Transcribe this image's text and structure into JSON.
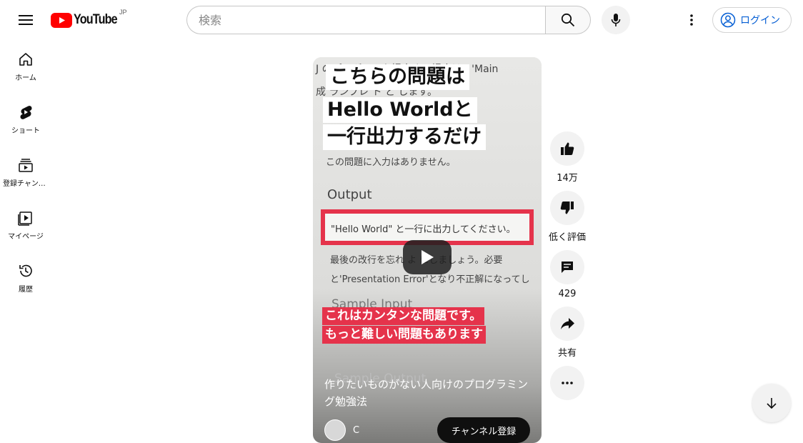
{
  "header": {
    "logo_text": "YouTube",
    "region": "JP",
    "search_placeholder": "検索",
    "login_label": "ログイン"
  },
  "sidebar": {
    "items": [
      {
        "label": "ホーム",
        "icon": "home-icon"
      },
      {
        "label": "ショート",
        "icon": "shorts-icon"
      },
      {
        "label": "登録チャンネル",
        "icon": "subscriptions-icon"
      },
      {
        "label": "マイページ",
        "icon": "library-icon"
      },
      {
        "label": "履歴",
        "icon": "history-icon"
      }
    ]
  },
  "video": {
    "caption_top_1": "こちらの問題は",
    "caption_top_2": "Hello Worldと",
    "caption_top_3": "一行出力するだけ",
    "doc_line_1": "J   のプログラムを提出する場合は、'Main",
    "doc_line_2": "成   ランプレ  ト  と   します。",
    "doc_line_3": "この問題に入力はありません。",
    "doc_output_heading": "Output",
    "doc_output_text": "\"Hello World\" と一行に出力してください。",
    "doc_line_4": "最後の改行を忘れ   よ  にしましょう。必要",
    "doc_line_5": "と'Presentation Error'となり不正解になってし",
    "doc_sample_input": "Sample Input",
    "doc_sample_output": "Sample Output",
    "caption_red_1": "これはカンタンな問題です。",
    "caption_red_2": "もっと難しい問題もあります",
    "title": "作りたいものがない人向けのプログラミング勉強法",
    "channel_name": "C",
    "subscribe_label": "チャンネル登録"
  },
  "actions": {
    "like_count": "14万",
    "dislike_label": "低く評価",
    "comment_count": "429",
    "share_label": "共有"
  },
  "colors": {
    "brand_red": "#ff0000",
    "caption_red": "#e5334b",
    "link_blue": "#065fd4"
  }
}
